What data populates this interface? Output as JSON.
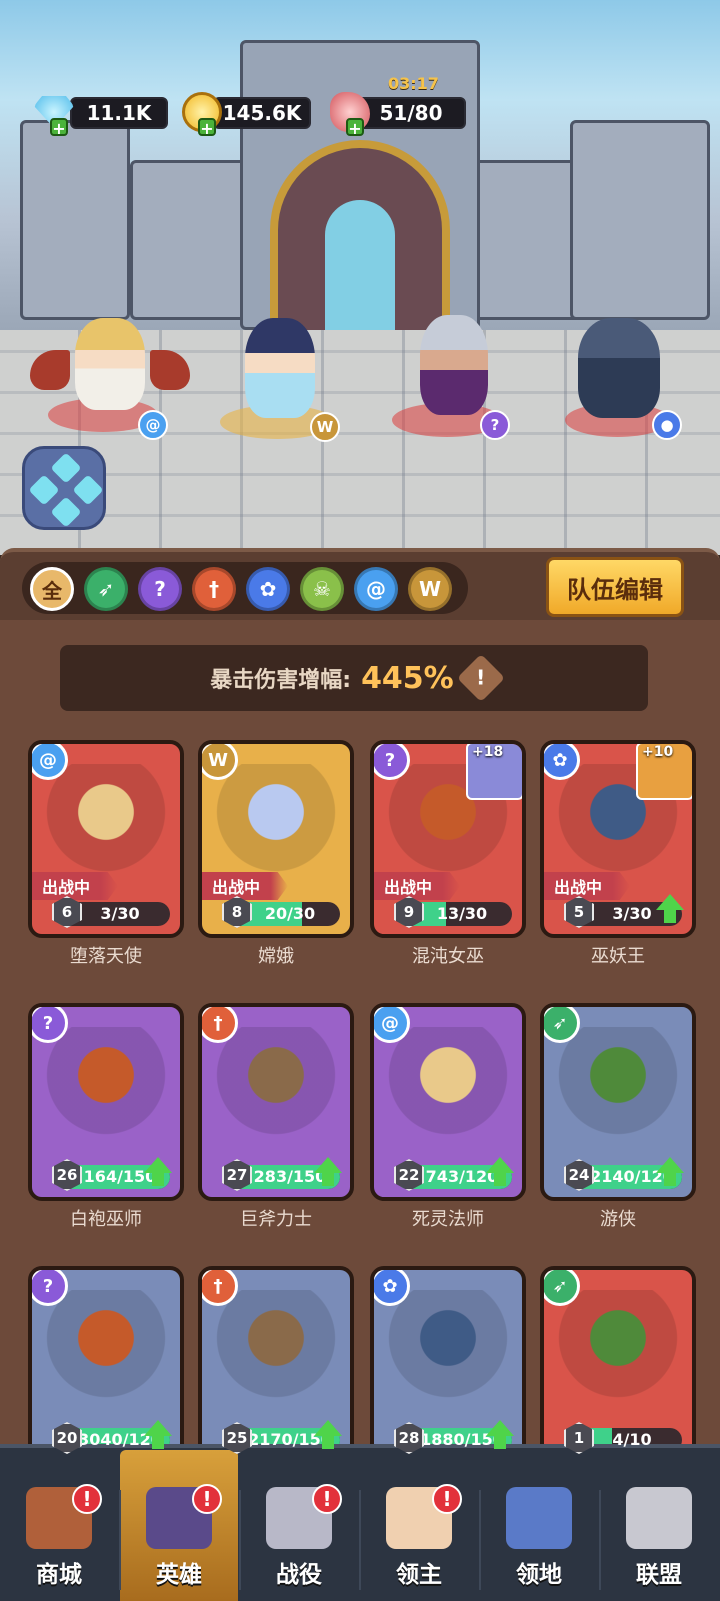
{
  "resources": {
    "gems": "11.1K",
    "gold": "145.6K",
    "stamina": "51/80",
    "stamina_timer": "03:17"
  },
  "team_heroes": [
    {
      "name": "堕落天使",
      "element_icon": "spiral-icon",
      "color": "#5aa0f0"
    },
    {
      "name": "嫦娥",
      "element_icon": "wings-icon",
      "color": "#d8a040"
    },
    {
      "name": "混沌女巫",
      "element_icon": "hook-icon",
      "color": "#8a5ad8"
    },
    {
      "name": "巫妖王",
      "element_icon": "paw-icon",
      "color": "#4a7ae8"
    }
  ],
  "filters": [
    {
      "label": "全",
      "icon": "all-icon",
      "color": "#e8b86a"
    },
    {
      "label": "",
      "icon": "bow-icon",
      "color": "#3bb06a"
    },
    {
      "label": "",
      "icon": "hook-icon",
      "color": "#8a5ad8"
    },
    {
      "label": "",
      "icon": "sword-icon",
      "color": "#e0603a"
    },
    {
      "label": "",
      "icon": "paw-icon",
      "color": "#4a7ae8"
    },
    {
      "label": "",
      "icon": "skull-icon",
      "color": "#8ac04a"
    },
    {
      "label": "",
      "icon": "spiral-icon",
      "color": "#4aa0f0"
    },
    {
      "label": "",
      "icon": "wings-icon",
      "color": "#c8963a"
    }
  ],
  "team_edit_label": "队伍编辑",
  "crit_label": "暴击伤害增幅:",
  "crit_value": "445%",
  "deployed_label": "出战中",
  "heroes": [
    {
      "name": "堕落天使",
      "level": "6",
      "progress": "3/30",
      "fraction": 0.1,
      "element": "spiral",
      "bg": "#d9544a",
      "deployed": true,
      "upgrade": false,
      "equip": ""
    },
    {
      "name": "嫦娥",
      "level": "8",
      "progress": "20/30",
      "fraction": 0.67,
      "element": "wings",
      "bg": "#e8b04a",
      "deployed": true,
      "upgrade": false,
      "equip": ""
    },
    {
      "name": "混沌女巫",
      "level": "9",
      "progress": "13/30",
      "fraction": 0.43,
      "element": "hook",
      "bg": "#d9544a",
      "deployed": true,
      "upgrade": false,
      "equip": "+18"
    },
    {
      "name": "巫妖王",
      "level": "5",
      "progress": "3/30",
      "fraction": 0.1,
      "element": "paw",
      "bg": "#d9544a",
      "deployed": true,
      "upgrade": true,
      "equip": "+10"
    },
    {
      "name": "白袍巫师",
      "level": "26",
      "progress": "164/150",
      "fraction": 1,
      "element": "hook",
      "bg": "#9a62c8",
      "deployed": false,
      "upgrade": true,
      "equip": ""
    },
    {
      "name": "巨斧力士",
      "level": "27",
      "progress": "283/150",
      "fraction": 1,
      "element": "sword",
      "bg": "#9a62c8",
      "deployed": false,
      "upgrade": true,
      "equip": ""
    },
    {
      "name": "死灵法师",
      "level": "22",
      "progress": "743/120",
      "fraction": 1,
      "element": "spiral",
      "bg": "#9a62c8",
      "deployed": false,
      "upgrade": true,
      "equip": ""
    },
    {
      "name": "游侠",
      "level": "24",
      "progress": "2140/120",
      "fraction": 1,
      "element": "bow",
      "bg": "#7a8cb8",
      "deployed": false,
      "upgrade": true,
      "equip": ""
    },
    {
      "name": "",
      "level": "20",
      "progress": "3040/120",
      "fraction": 1,
      "element": "hook",
      "bg": "#7a8cb8",
      "deployed": false,
      "upgrade": true,
      "equip": ""
    },
    {
      "name": "",
      "level": "25",
      "progress": "2170/150",
      "fraction": 1,
      "element": "sword",
      "bg": "#7a8cb8",
      "deployed": false,
      "upgrade": true,
      "equip": ""
    },
    {
      "name": "",
      "level": "28",
      "progress": "1880/150",
      "fraction": 1,
      "element": "paw",
      "bg": "#7a8cb8",
      "deployed": false,
      "upgrade": true,
      "equip": ""
    },
    {
      "name": "",
      "level": "1",
      "progress": "4/10",
      "fraction": 0.4,
      "element": "bow",
      "bg": "#d9544a",
      "deployed": false,
      "upgrade": false,
      "equip": ""
    }
  ],
  "nav": [
    {
      "label": "商城",
      "icon": "chest-icon",
      "alert": "!"
    },
    {
      "label": "英雄",
      "icon": "hero-cards-icon",
      "alert": "!"
    },
    {
      "label": "战役",
      "icon": "crossed-swords-icon",
      "alert": "!"
    },
    {
      "label": "领主",
      "icon": "king-icon",
      "alert": "!"
    },
    {
      "label": "领地",
      "icon": "castle-icon",
      "alert": ""
    },
    {
      "label": "联盟",
      "icon": "knight-helmet-icon",
      "alert": ""
    }
  ]
}
